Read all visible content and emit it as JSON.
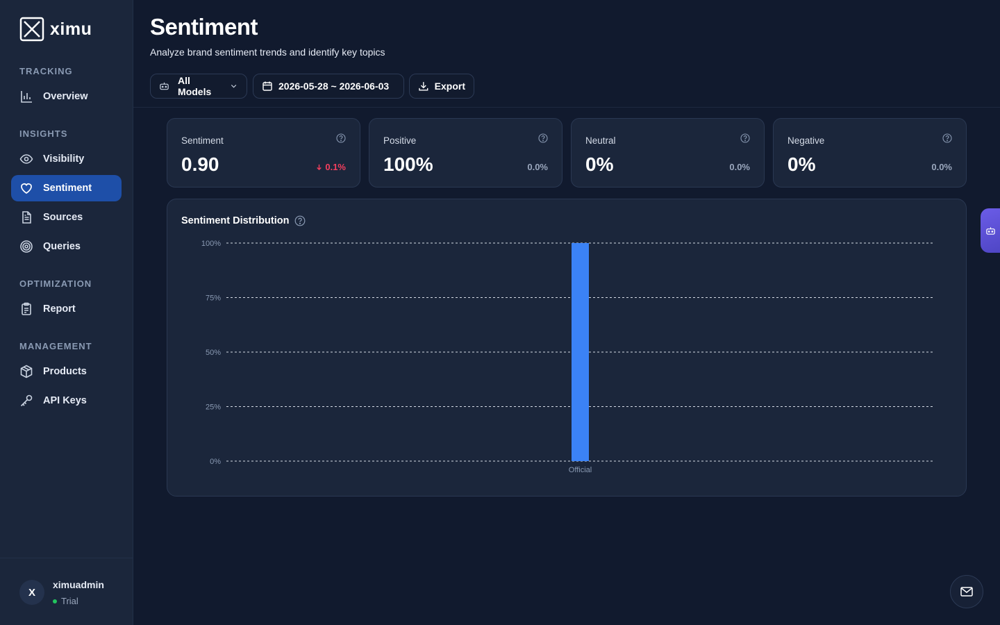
{
  "app": {
    "name": "ximu"
  },
  "sidebar": {
    "sections": [
      {
        "title": "TRACKING",
        "items": [
          {
            "label": "Overview",
            "icon": "bar-chart-icon",
            "active": false
          }
        ]
      },
      {
        "title": "INSIGHTS",
        "items": [
          {
            "label": "Visibility",
            "icon": "eye-icon",
            "active": false
          },
          {
            "label": "Sentiment",
            "icon": "heart-icon",
            "active": true
          },
          {
            "label": "Sources",
            "icon": "document-icon",
            "active": false
          },
          {
            "label": "Queries",
            "icon": "target-icon",
            "active": false
          }
        ]
      },
      {
        "title": "OPTIMIZATION",
        "items": [
          {
            "label": "Report",
            "icon": "clipboard-icon",
            "active": false
          }
        ]
      },
      {
        "title": "MANAGEMENT",
        "items": [
          {
            "label": "Products",
            "icon": "box-icon",
            "active": false
          },
          {
            "label": "API Keys",
            "icon": "key-icon",
            "active": false
          }
        ]
      }
    ],
    "user": {
      "initial": "X",
      "name": "ximuadmin",
      "plan": "Trial",
      "plan_color": "#22c55e"
    }
  },
  "header": {
    "title": "Sentiment",
    "subtitle": "Analyze brand sentiment trends and identify key topics",
    "models_label": "All Models",
    "date_range": "2026-05-28 ~ 2026-06-03",
    "export_label": "Export"
  },
  "stats": [
    {
      "label": "Sentiment",
      "value": "0.90",
      "delta": "0.1%",
      "trend": "down"
    },
    {
      "label": "Positive",
      "value": "100%",
      "delta": "0.0%",
      "trend": "flat"
    },
    {
      "label": "Neutral",
      "value": "0%",
      "delta": "0.0%",
      "trend": "flat"
    },
    {
      "label": "Negative",
      "value": "0%",
      "delta": "0.0%",
      "trend": "flat"
    }
  ],
  "colors": {
    "accent": "#1e4fa8",
    "bar": "#3b82f6",
    "negative": "#f43f5e"
  },
  "chart_data": {
    "type": "bar",
    "title": "Sentiment Distribution",
    "categories": [
      "Official"
    ],
    "values": [
      100
    ],
    "ylim": [
      0,
      100
    ],
    "yticks": [
      "0%",
      "25%",
      "50%",
      "75%",
      "100%"
    ],
    "grid": true
  }
}
